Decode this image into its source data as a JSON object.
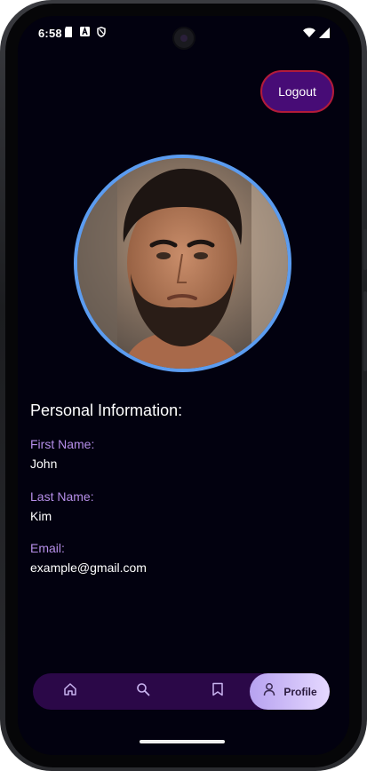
{
  "status_bar": {
    "time": "6:58",
    "left_icons": [
      "sd-card-icon",
      "a-box-icon",
      "shield-icon"
    ],
    "right_icons": [
      "wifi-icon",
      "signal-icon"
    ]
  },
  "header": {
    "logout_label": "Logout"
  },
  "profile": {
    "section_title": "Personal Information:",
    "fields": [
      {
        "label": "First Name:",
        "value": "John"
      },
      {
        "label": "Last Name:",
        "value": "Kim"
      },
      {
        "label": "Email:",
        "value": "example@gmail.com"
      }
    ]
  },
  "bottom_nav": {
    "items": [
      {
        "icon": "home-icon",
        "label": ""
      },
      {
        "icon": "search-icon",
        "label": ""
      },
      {
        "icon": "bookmark-icon",
        "label": ""
      },
      {
        "icon": "person-icon",
        "label": "Profile",
        "active": true
      }
    ]
  },
  "colors": {
    "background": "#02010f",
    "logout_fill": "#470c76",
    "logout_border": "#b31b3a",
    "avatar_ring": "#5b9cf0",
    "label_purple": "#b58ee8",
    "nav_bg": "#2b0848",
    "nav_active": "#d6c6fb"
  }
}
